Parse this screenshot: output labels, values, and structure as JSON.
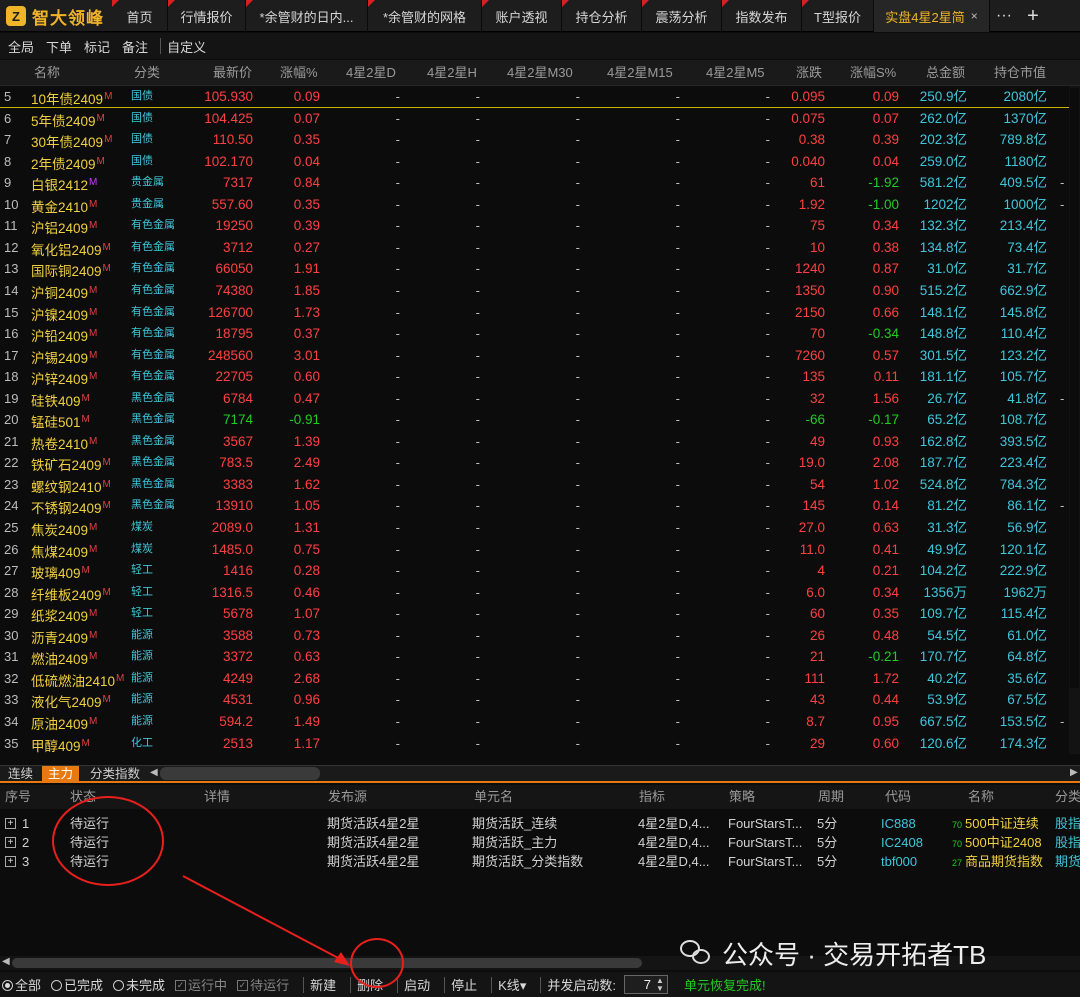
{
  "app": {
    "logo_text": "智大领峰",
    "logo_mark": "Z"
  },
  "tabs": [
    {
      "label": "首页"
    },
    {
      "label": "行情报价"
    },
    {
      "label": "*余管财的日内..."
    },
    {
      "label": "*余管财的网格"
    },
    {
      "label": "账户透视"
    },
    {
      "label": "持仓分析"
    },
    {
      "label": "震荡分析"
    },
    {
      "label": "指数发布"
    },
    {
      "label": "T型报价"
    },
    {
      "label": "实盘4星2星简"
    }
  ],
  "tab_close": "×",
  "more_label": "···",
  "add_label": "+",
  "toolbar": {
    "items": [
      "全局",
      "下单",
      "标记",
      "备注",
      "自定义"
    ]
  },
  "grid": {
    "headers": {
      "name": "名称",
      "cat": "分类",
      "last": "最新价",
      "chg": "涨幅%",
      "d": "4星2星D",
      "h": "4星2星H",
      "m30": "4星2星M30",
      "m15": "4星2星M15",
      "m5": "4星2星M5",
      "ud": "涨跌",
      "pct": "涨幅S%",
      "amt": "总金额",
      "cap": "持仓市值"
    },
    "rows": [
      {
        "idx": "5",
        "name": "10年债2409",
        "m": "M",
        "cat": "国债",
        "last": "105.930",
        "chg": "0.09",
        "ud": "0.095",
        "pct": "0.09",
        "amt": "250.9亿",
        "cap": "2080亿",
        "ext": ""
      },
      {
        "idx": "6",
        "name": "5年债2409",
        "m": "M",
        "cat": "国债",
        "last": "104.425",
        "chg": "0.07",
        "ud": "0.075",
        "pct": "0.07",
        "amt": "262.0亿",
        "cap": "1370亿",
        "ext": ""
      },
      {
        "idx": "7",
        "name": "30年债2409",
        "m": "M",
        "cat": "国债",
        "last": "110.50",
        "chg": "0.35",
        "ud": "0.38",
        "pct": "0.39",
        "amt": "202.3亿",
        "cap": "789.8亿",
        "ext": ""
      },
      {
        "idx": "8",
        "name": "2年债2409",
        "m": "M",
        "cat": "国债",
        "last": "102.170",
        "chg": "0.04",
        "ud": "0.040",
        "pct": "0.04",
        "amt": "259.0亿",
        "cap": "1180亿",
        "ext": ""
      },
      {
        "idx": "9",
        "name": "白银2412",
        "m": "M",
        "cat": "贵金属",
        "last": "7317",
        "chg": "0.84",
        "ud": "61",
        "pct": "-1.92",
        "amt": "581.2亿",
        "cap": "409.5亿",
        "ext": "-"
      },
      {
        "idx": "10",
        "name": "黄金2410",
        "m": "M",
        "cat": "贵金属",
        "last": "557.60",
        "chg": "0.35",
        "ud": "1.92",
        "pct": "-1.00",
        "amt": "1202亿",
        "cap": "1000亿",
        "ext": "-"
      },
      {
        "idx": "11",
        "name": "沪铝2409",
        "m": "M",
        "cat": "有色金属",
        "last": "19250",
        "chg": "0.39",
        "ud": "75",
        "pct": "0.34",
        "amt": "132.3亿",
        "cap": "213.4亿",
        "ext": ""
      },
      {
        "idx": "12",
        "name": "氧化铝2409",
        "m": "M",
        "cat": "有色金属",
        "last": "3712",
        "chg": "0.27",
        "ud": "10",
        "pct": "0.38",
        "amt": "134.8亿",
        "cap": "73.4亿",
        "ext": ""
      },
      {
        "idx": "13",
        "name": "国际铜2409",
        "m": "M",
        "cat": "有色金属",
        "last": "66050",
        "chg": "1.91",
        "ud": "1240",
        "pct": "0.87",
        "amt": "31.0亿",
        "cap": "31.7亿",
        "ext": ""
      },
      {
        "idx": "14",
        "name": "沪铜2409",
        "m": "M",
        "cat": "有色金属",
        "last": "74380",
        "chg": "1.85",
        "ud": "1350",
        "pct": "0.90",
        "amt": "515.2亿",
        "cap": "662.9亿",
        "ext": ""
      },
      {
        "idx": "15",
        "name": "沪镍2409",
        "m": "M",
        "cat": "有色金属",
        "last": "126700",
        "chg": "1.73",
        "ud": "2150",
        "pct": "0.66",
        "amt": "148.1亿",
        "cap": "145.8亿",
        "ext": ""
      },
      {
        "idx": "16",
        "name": "沪铅2409",
        "m": "M",
        "cat": "有色金属",
        "last": "18795",
        "chg": "0.37",
        "ud": "70",
        "pct": "-0.34",
        "amt": "148.8亿",
        "cap": "110.4亿",
        "ext": ""
      },
      {
        "idx": "17",
        "name": "沪锡2409",
        "m": "M",
        "cat": "有色金属",
        "last": "248560",
        "chg": "3.01",
        "ud": "7260",
        "pct": "0.57",
        "amt": "301.5亿",
        "cap": "123.2亿",
        "ext": ""
      },
      {
        "idx": "18",
        "name": "沪锌2409",
        "m": "M",
        "cat": "有色金属",
        "last": "22705",
        "chg": "0.60",
        "ud": "135",
        "pct": "0.11",
        "amt": "181.1亿",
        "cap": "105.7亿",
        "ext": ""
      },
      {
        "idx": "19",
        "name": "硅铁409",
        "m": "M",
        "cat": "黑色金属",
        "last": "6784",
        "chg": "0.47",
        "ud": "32",
        "pct": "1.56",
        "amt": "26.7亿",
        "cap": "41.8亿",
        "ext": "-"
      },
      {
        "idx": "20",
        "name": "锰硅501",
        "m": "M",
        "cat": "黑色金属",
        "last": "7174",
        "chg": "-0.91",
        "ud": "-66",
        "pct": "-0.17",
        "amt": "65.2亿",
        "cap": "108.7亿",
        "ext": ""
      },
      {
        "idx": "21",
        "name": "热卷2410",
        "m": "M",
        "cat": "黑色金属",
        "last": "3567",
        "chg": "1.39",
        "ud": "49",
        "pct": "0.93",
        "amt": "162.8亿",
        "cap": "393.5亿",
        "ext": ""
      },
      {
        "idx": "22",
        "name": "铁矿石2409",
        "m": "M",
        "cat": "黑色金属",
        "last": "783.5",
        "chg": "2.49",
        "ud": "19.0",
        "pct": "2.08",
        "amt": "187.7亿",
        "cap": "223.4亿",
        "ext": ""
      },
      {
        "idx": "23",
        "name": "螺纹钢2410",
        "m": "M",
        "cat": "黑色金属",
        "last": "3383",
        "chg": "1.62",
        "ud": "54",
        "pct": "1.02",
        "amt": "524.8亿",
        "cap": "784.3亿",
        "ext": ""
      },
      {
        "idx": "24",
        "name": "不锈钢2409",
        "m": "M",
        "cat": "黑色金属",
        "last": "13910",
        "chg": "1.05",
        "ud": "145",
        "pct": "0.14",
        "amt": "81.2亿",
        "cap": "86.1亿",
        "ext": "-"
      },
      {
        "idx": "25",
        "name": "焦炭2409",
        "m": "M",
        "cat": "煤炭",
        "last": "2089.0",
        "chg": "1.31",
        "ud": "27.0",
        "pct": "0.63",
        "amt": "31.3亿",
        "cap": "56.9亿",
        "ext": ""
      },
      {
        "idx": "26",
        "name": "焦煤2409",
        "m": "M",
        "cat": "煤炭",
        "last": "1485.0",
        "chg": "0.75",
        "ud": "11.0",
        "pct": "0.41",
        "amt": "49.9亿",
        "cap": "120.1亿",
        "ext": ""
      },
      {
        "idx": "27",
        "name": "玻璃409",
        "m": "M",
        "cat": "轻工",
        "last": "1416",
        "chg": "0.28",
        "ud": "4",
        "pct": "0.21",
        "amt": "104.2亿",
        "cap": "222.9亿",
        "ext": ""
      },
      {
        "idx": "28",
        "name": "纤维板2409",
        "m": "M",
        "cat": "轻工",
        "last": "1316.5",
        "chg": "0.46",
        "ud": "6.0",
        "pct": "0.34",
        "amt": "1356万",
        "cap": "1962万",
        "ext": ""
      },
      {
        "idx": "29",
        "name": "纸浆2409",
        "m": "M",
        "cat": "轻工",
        "last": "5678",
        "chg": "1.07",
        "ud": "60",
        "pct": "0.35",
        "amt": "109.7亿",
        "cap": "115.4亿",
        "ext": ""
      },
      {
        "idx": "30",
        "name": "沥青2409",
        "m": "M",
        "cat": "能源",
        "last": "3588",
        "chg": "0.73",
        "ud": "26",
        "pct": "0.48",
        "amt": "54.5亿",
        "cap": "61.0亿",
        "ext": ""
      },
      {
        "idx": "31",
        "name": "燃油2409",
        "m": "M",
        "cat": "能源",
        "last": "3372",
        "chg": "0.63",
        "ud": "21",
        "pct": "-0.21",
        "amt": "170.7亿",
        "cap": "64.8亿",
        "ext": ""
      },
      {
        "idx": "32",
        "name": "低硫燃油2410",
        "m": "M",
        "cat": "能源",
        "last": "4249",
        "chg": "2.68",
        "ud": "111",
        "pct": "1.72",
        "amt": "40.2亿",
        "cap": "35.6亿",
        "ext": ""
      },
      {
        "idx": "33",
        "name": "液化气2409",
        "m": "M",
        "cat": "能源",
        "last": "4531",
        "chg": "0.96",
        "ud": "43",
        "pct": "0.44",
        "amt": "53.9亿",
        "cap": "67.5亿",
        "ext": ""
      },
      {
        "idx": "34",
        "name": "原油2409",
        "m": "M",
        "cat": "能源",
        "last": "594.2",
        "chg": "1.49",
        "ud": "8.7",
        "pct": "0.95",
        "amt": "667.5亿",
        "cap": "153.5亿",
        "ext": "-"
      },
      {
        "idx": "35",
        "name": "甲醇409",
        "m": "M",
        "cat": "化工",
        "last": "2513",
        "chg": "1.17",
        "ud": "29",
        "pct": "0.60",
        "amt": "120.6亿",
        "cap": "174.3亿",
        "ext": ""
      }
    ],
    "dash": "-"
  },
  "bottom_tabs": [
    {
      "label": "连续"
    },
    {
      "label": "主力"
    },
    {
      "label": "分类指数"
    }
  ],
  "lower": {
    "headers": {
      "seq": "序号",
      "state": "状态",
      "detail": "详情",
      "source": "发布源",
      "unit": "单元名",
      "indicator": "指标",
      "strategy": "策略",
      "period": "周期",
      "code": "代码",
      "sname": "名称",
      "cls": "分类"
    },
    "rows": [
      {
        "seq": "1",
        "state": "待运行",
        "source": "期货活跃4星2星",
        "unit": "期货活跃_连续",
        "indicator": "4星2星D,4...",
        "strategy": "FourStarsT...",
        "period": "5分",
        "code": "IC888",
        "num": "70",
        "sname": "500中证连续",
        "cls": "股指"
      },
      {
        "seq": "2",
        "state": "待运行",
        "source": "期货活跃4星2星",
        "unit": "期货活跃_主力",
        "indicator": "4星2星D,4...",
        "strategy": "FourStarsT...",
        "period": "5分",
        "code": "IC2408",
        "num": "70",
        "sname": "500中证2408",
        "cls": "股指"
      },
      {
        "seq": "3",
        "state": "待运行",
        "source": "期货活跃4星2星",
        "unit": "期货活跃_分类指数",
        "indicator": "4星2星D,4...",
        "strategy": "FourStarsT...",
        "period": "5分",
        "code": "tbf000",
        "num": "27",
        "sname": "商品期货指数",
        "cls": "期货"
      }
    ]
  },
  "actions": {
    "filter_all": "全部",
    "filter_done": "已完成",
    "filter_undone": "未完成",
    "running": "运行中",
    "waiting": "待运行",
    "new": "新建",
    "delete": "删除",
    "start": "启动",
    "stop": "停止",
    "kline": "K线",
    "concurrency_label": "并发启动数:",
    "concurrency_value": "7",
    "status": "单元恢复完成!"
  },
  "watermark": {
    "text": "公众号 · 交易开拓者TB"
  },
  "colors": {
    "accent": "#f0b429",
    "up": "#ff4040",
    "down": "#22cc22",
    "cyan": "#3fc6d9",
    "annotation": "#e8201c"
  }
}
